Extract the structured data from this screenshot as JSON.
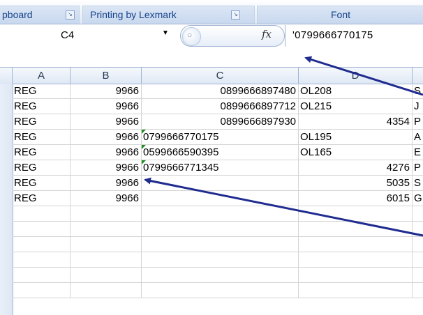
{
  "ribbon": {
    "groups": [
      {
        "label": "pboard"
      },
      {
        "label": "Printing by Lexmark"
      },
      {
        "label": "Font"
      }
    ]
  },
  "formula_bar": {
    "name_box": "C4",
    "formula": "'0799666770175",
    "fx_label": "fx"
  },
  "grid": {
    "columns": [
      "A",
      "B",
      "C",
      "D"
    ],
    "rows": [
      [
        "REG",
        "9966",
        "0899666897480",
        "OL208",
        "S"
      ],
      [
        "REG",
        "9966",
        "0899666897712",
        "OL215",
        "J"
      ],
      [
        "REG",
        "9966",
        "0899666897930",
        "4354",
        "P"
      ],
      [
        "REG",
        "9966",
        "0799666770175",
        "OL195",
        "A"
      ],
      [
        "REG",
        "9966",
        "0599666590395",
        "OL165",
        "E"
      ],
      [
        "REG",
        "9966",
        "0799666771345",
        "4276",
        "P"
      ],
      [
        "REG",
        "9966",
        "",
        "5035",
        "S"
      ],
      [
        "REG",
        "9966",
        "",
        "6015",
        "G"
      ]
    ]
  },
  "colors": {
    "accent": "#1f2b8f",
    "ribbon_text": "#15428b",
    "error_triangle": "#1f8f1f"
  }
}
